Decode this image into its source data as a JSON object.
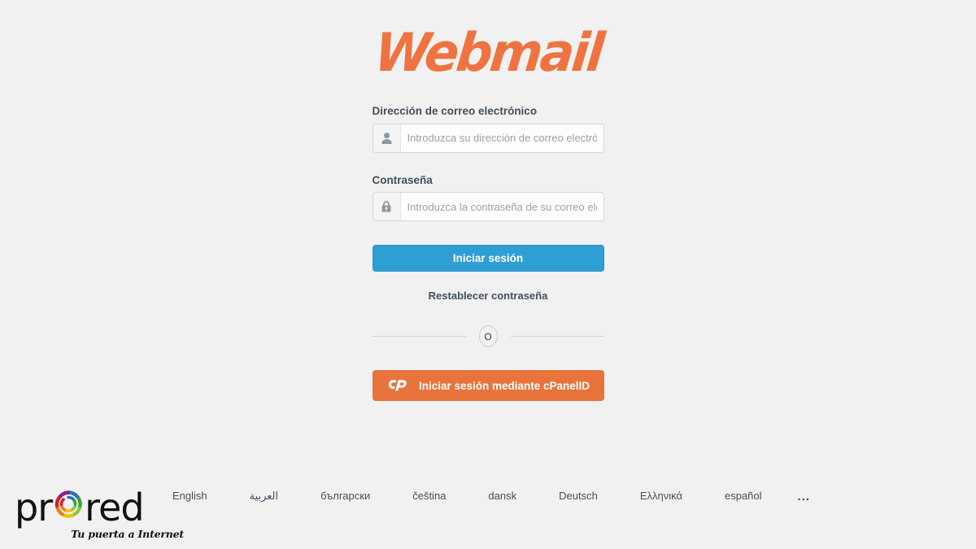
{
  "brand": {
    "logo_text": "Webmail",
    "logo_color": "#ef7340"
  },
  "form": {
    "email": {
      "label": "Dirección de correo electrónico",
      "placeholder": "Introduzca su dirección de correo electrónico",
      "value": "",
      "icon": "user-icon"
    },
    "password": {
      "label": "Contraseña",
      "placeholder": "Introduzca la contraseña de su correo electrónico",
      "value": "",
      "icon": "lock-icon"
    },
    "login_button": {
      "label": "Iniciar sesión",
      "color": "#2e9fd4"
    },
    "reset_link": "Restablecer contraseña",
    "divider_label": "O",
    "cpanelid_button": {
      "label": "Iniciar sesión mediante cPanelID",
      "color": "#e8743b",
      "icon": "cpanel-logo-icon"
    }
  },
  "languages": {
    "items": [
      {
        "label": "English"
      },
      {
        "label": "العربية"
      },
      {
        "label": "български"
      },
      {
        "label": "čeština"
      },
      {
        "label": "dansk"
      },
      {
        "label": "Deutsch"
      },
      {
        "label": "Ελληνικά"
      },
      {
        "label": "español"
      }
    ],
    "more_label": "..."
  },
  "provider": {
    "name_part1": "pr",
    "name_part2": "red",
    "swirl_icon": "prored-swirl-icon",
    "tagline": "Tu puerta a Internet",
    "swirl_colors": [
      "#2b74b8",
      "#3aa23a",
      "#8cc63f",
      "#f2c200",
      "#f07d1e",
      "#cf2127",
      "#8e1f8e"
    ]
  }
}
